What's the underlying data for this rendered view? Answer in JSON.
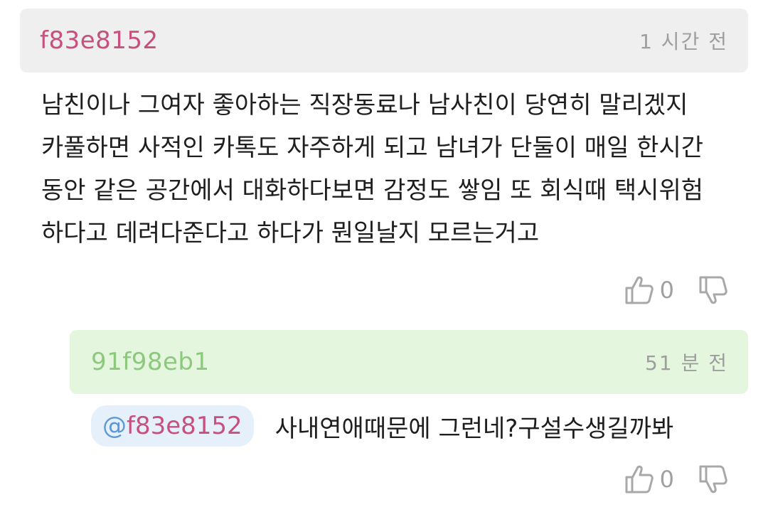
{
  "comment": {
    "author": "f83e8152",
    "time": "1 시간 전",
    "text": "남친이나 그여자 좋아하는 직장동료나 남사친이 당연히 말리겠지\n카풀하면 사적인 카톡도 자주하게 되고 남녀가 단둘이 매일 한시간\n동안 같은 공간에서 대화하다보면 감정도 쌓임 또 회식때 택시위험\n하다고 데려다준다고 하다가 뭔일날지 모르는거고",
    "like_count": "0",
    "like_icon": "thumbs-up-icon",
    "dislike_icon": "thumbs-down-icon"
  },
  "reply": {
    "author": "91f98eb1",
    "time": "51 분 전",
    "mention_at": "@",
    "mention_id": "f83e8152",
    "text": "사내연애때문에 그런네?구설수생길까봐",
    "like_count": "0",
    "like_icon": "thumbs-up-icon",
    "dislike_icon": "thumbs-down-icon"
  },
  "colors": {
    "main_header_bg": "#efefef",
    "reply_header_bg": "#e4f6de",
    "main_author": "#c8507e",
    "reply_author": "#8cc97f",
    "mention_bg": "#e6f0fa",
    "mention_at": "#5a98d6"
  }
}
